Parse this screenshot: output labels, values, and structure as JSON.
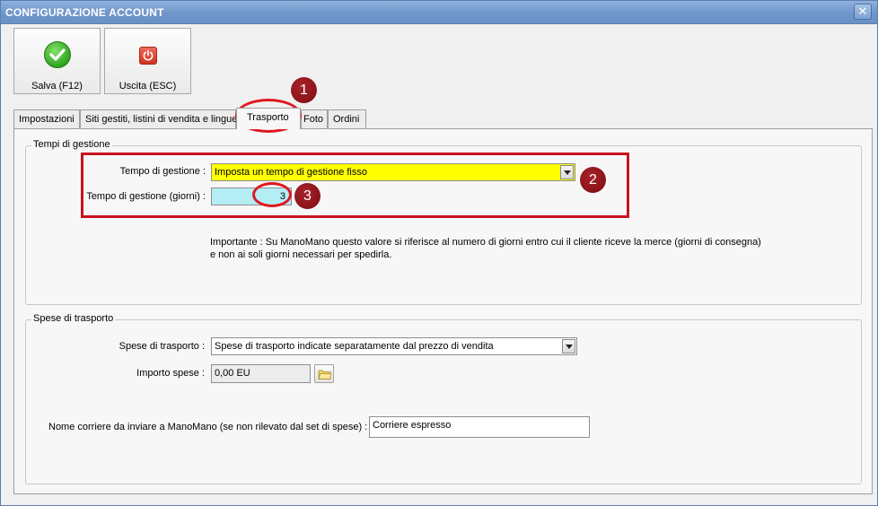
{
  "window": {
    "title": "CONFIGURAZIONE ACCOUNT",
    "close_glyph": "✕"
  },
  "toolbar": {
    "save_label": "Salva (F12)",
    "save_icon": "check-icon",
    "exit_label": "Uscita (ESC)",
    "exit_icon": "power-icon"
  },
  "tabs": [
    {
      "label": "Impostazioni"
    },
    {
      "label": "Siti gestiti, listini di vendita e lingue"
    },
    {
      "label": "Trasporto"
    },
    {
      "label": "Foto"
    },
    {
      "label": "Ordini"
    }
  ],
  "active_tab": "Trasporto",
  "tempi": {
    "group_title": "Tempi di gestione",
    "tempo_label": "Tempo di gestione :",
    "tempo_value": "Imposta un tempo di gestione fisso",
    "giorni_label": "Tempo di gestione (giorni) :",
    "giorni_value": "3",
    "note_line1": "Importante : Su ManoMano questo valore si riferisce al numero di giorni entro cui il cliente riceve la merce (giorni di consegna)",
    "note_line2": "e non ai soli giorni necessari per spedirla."
  },
  "spese": {
    "group_title": "Spese di trasporto",
    "spese_label": "Spese di trasporto :",
    "spese_value": "Spese di trasporto indicate separatamente dal prezzo di vendita",
    "importo_label": "Importo spese :",
    "importo_value": "0,00 EU",
    "corriere_label": "Nome corriere da inviare a ManoMano (se non rilevato dal set di spese) :",
    "corriere_value": "Corriere espresso"
  },
  "annotations": {
    "badge1": "1",
    "badge2": "2",
    "badge3": "3"
  },
  "colors": {
    "titlebar": "#7399cc",
    "highlight_yellow": "#ffff00",
    "highlight_cyan": "#b4eef5",
    "annotation_red": "#c8141e",
    "badge": "#8b1117"
  }
}
